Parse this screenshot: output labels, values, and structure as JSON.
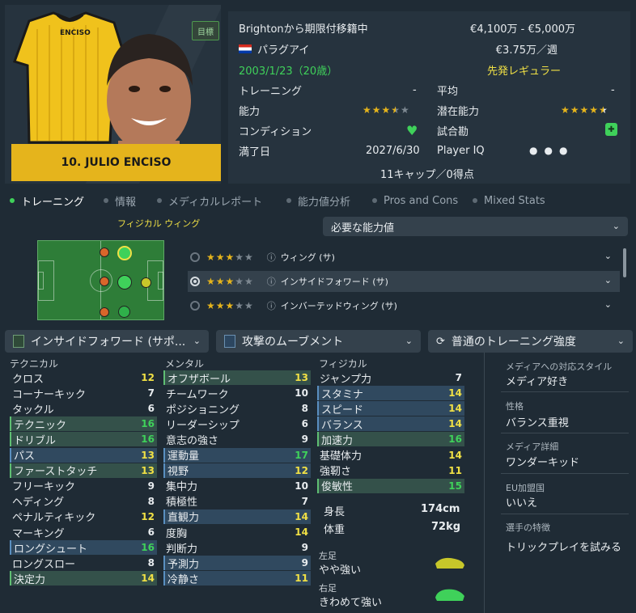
{
  "player": {
    "name": "10. JULIO ENCISO",
    "shirt_name": "ENCISO",
    "badge": "目標",
    "loan_status": "Brightonから期限付移籍中",
    "value_range": "€4,100万 - €5,000万",
    "nationality": "パラグアイ",
    "wage": "€3.75万／週",
    "dob_age": "2003/1/23（20歳）",
    "squad_status": "先発レギュラー",
    "training_label": "トレーニング",
    "training_value": "-",
    "average_label": "平均",
    "average_value": "-",
    "ability_label": "能力",
    "ability_stars": 3.5,
    "potential_label": "潜在能力",
    "potential_stars": 4.5,
    "condition_label": "コンディション",
    "sharpness_label": "試合勘",
    "contract_label": "満了日",
    "contract_value": "2027/6/30",
    "playeriq_label": "Player IQ",
    "caps": "11キャップ／0得点"
  },
  "tabs": [
    "トレーニング",
    "情報",
    "メディカルレポート",
    "能力値分析",
    "Pros and Cons",
    "Mixed Stats"
  ],
  "training": {
    "focus_label": "フィジカル ウィング",
    "required_attrs_dropdown": "必要な能力値",
    "roles": [
      {
        "stars": 3,
        "label": "ウィング (サ)",
        "selected": false
      },
      {
        "stars": 3,
        "label": "インサイドフォワード (サ)",
        "selected": true
      },
      {
        "stars": 3,
        "label": "インバーテッドウィング (サ)",
        "selected": false
      }
    ],
    "role_dropdown": "インサイドフォワード (サポ...",
    "focus_dropdown": "攻撃のムーブメント",
    "intensity_dropdown": "普通のトレーニング強度"
  },
  "technical": {
    "title": "テクニカル",
    "rows": [
      {
        "name": "クロス",
        "value": "12"
      },
      {
        "name": "コーナーキック",
        "value": "7"
      },
      {
        "name": "タックル",
        "value": "6"
      },
      {
        "name": "テクニック",
        "value": "16"
      },
      {
        "name": "ドリブル",
        "value": "16"
      },
      {
        "name": "パス",
        "value": "13"
      },
      {
        "name": "ファーストタッチ",
        "value": "13"
      },
      {
        "name": "フリーキック",
        "value": "9"
      },
      {
        "name": "ヘディング",
        "value": "8"
      },
      {
        "name": "ペナルティキック",
        "value": "12"
      },
      {
        "name": "マーキング",
        "value": "6"
      },
      {
        "name": "ロングシュート",
        "value": "16"
      },
      {
        "name": "ロングスロー",
        "value": "8"
      },
      {
        "name": "決定力",
        "value": "14"
      }
    ]
  },
  "mental": {
    "title": "メンタル",
    "rows": [
      {
        "name": "オフザボール",
        "value": "13"
      },
      {
        "name": "チームワーク",
        "value": "10"
      },
      {
        "name": "ポジショニング",
        "value": "8"
      },
      {
        "name": "リーダーシップ",
        "value": "6"
      },
      {
        "name": "意志の強さ",
        "value": "9"
      },
      {
        "name": "運動量",
        "value": "17"
      },
      {
        "name": "視野",
        "value": "12"
      },
      {
        "name": "集中力",
        "value": "10"
      },
      {
        "name": "積極性",
        "value": "7"
      },
      {
        "name": "直観力",
        "value": "14"
      },
      {
        "name": "度胸",
        "value": "14"
      },
      {
        "name": "判断力",
        "value": "9"
      },
      {
        "name": "予測力",
        "value": "9"
      },
      {
        "name": "冷静さ",
        "value": "11"
      }
    ]
  },
  "physical": {
    "title": "フィジカル",
    "rows": [
      {
        "name": "ジャンプ力",
        "value": "7"
      },
      {
        "name": "スタミナ",
        "value": "14"
      },
      {
        "name": "スピード",
        "value": "14"
      },
      {
        "name": "バランス",
        "value": "14"
      },
      {
        "name": "加速力",
        "value": "16"
      },
      {
        "name": "基礎体力",
        "value": "14"
      },
      {
        "name": "強靭さ",
        "value": "11"
      },
      {
        "name": "俊敏性",
        "value": "15"
      }
    ],
    "height_label": "身長",
    "height": "174cm",
    "weight_label": "体重",
    "weight": "72kg",
    "left_foot_label": "左足",
    "left_foot": "やや強い",
    "right_foot_label": "右足",
    "right_foot": "きわめて強い"
  },
  "side_info": [
    {
      "label": "メディアへの対応スタイル",
      "value": "メディア好き"
    },
    {
      "label": "性格",
      "value": "バランス重視"
    },
    {
      "label": "メディア詳細",
      "value": "ワンダーキッド"
    },
    {
      "label": "EU加盟国",
      "value": "いいえ"
    },
    {
      "label": "選手の特徴",
      "value": "トリックプレイを試みる"
    }
  ],
  "colors": {
    "accent_green": "#3fd15a",
    "gold": "#e5b41c",
    "yellow_value": "#f0e045"
  }
}
